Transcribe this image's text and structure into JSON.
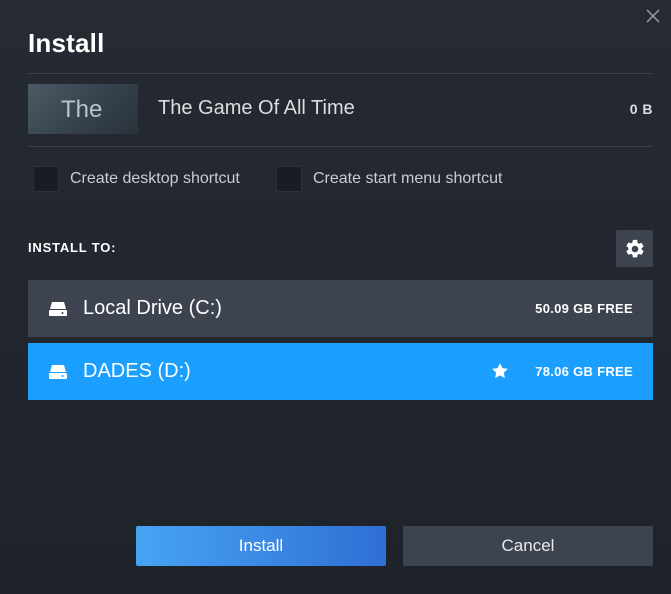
{
  "dialog": {
    "title": "Install",
    "close_icon": "close-icon"
  },
  "game": {
    "thumbnail_text": "The",
    "name": "The Game Of All Time",
    "size": "0 B"
  },
  "options": {
    "desktop_shortcut_label": "Create desktop shortcut",
    "desktop_shortcut_checked": false,
    "start_menu_shortcut_label": "Create start menu shortcut",
    "start_menu_shortcut_checked": false
  },
  "install_to": {
    "label": "INSTALL TO:",
    "settings_icon": "gear-icon",
    "drives": [
      {
        "name": "Local Drive (C:)",
        "free": "50.09 GB FREE",
        "selected": false,
        "default": false,
        "icon": "drive-icon"
      },
      {
        "name": "DADES (D:)",
        "free": "78.06 GB FREE",
        "selected": true,
        "default": true,
        "icon": "drive-icon"
      }
    ]
  },
  "buttons": {
    "install_label": "Install",
    "cancel_label": "Cancel"
  },
  "colors": {
    "accent": "#1a9fff",
    "panel": "#3d4450",
    "background": "#23262e"
  }
}
